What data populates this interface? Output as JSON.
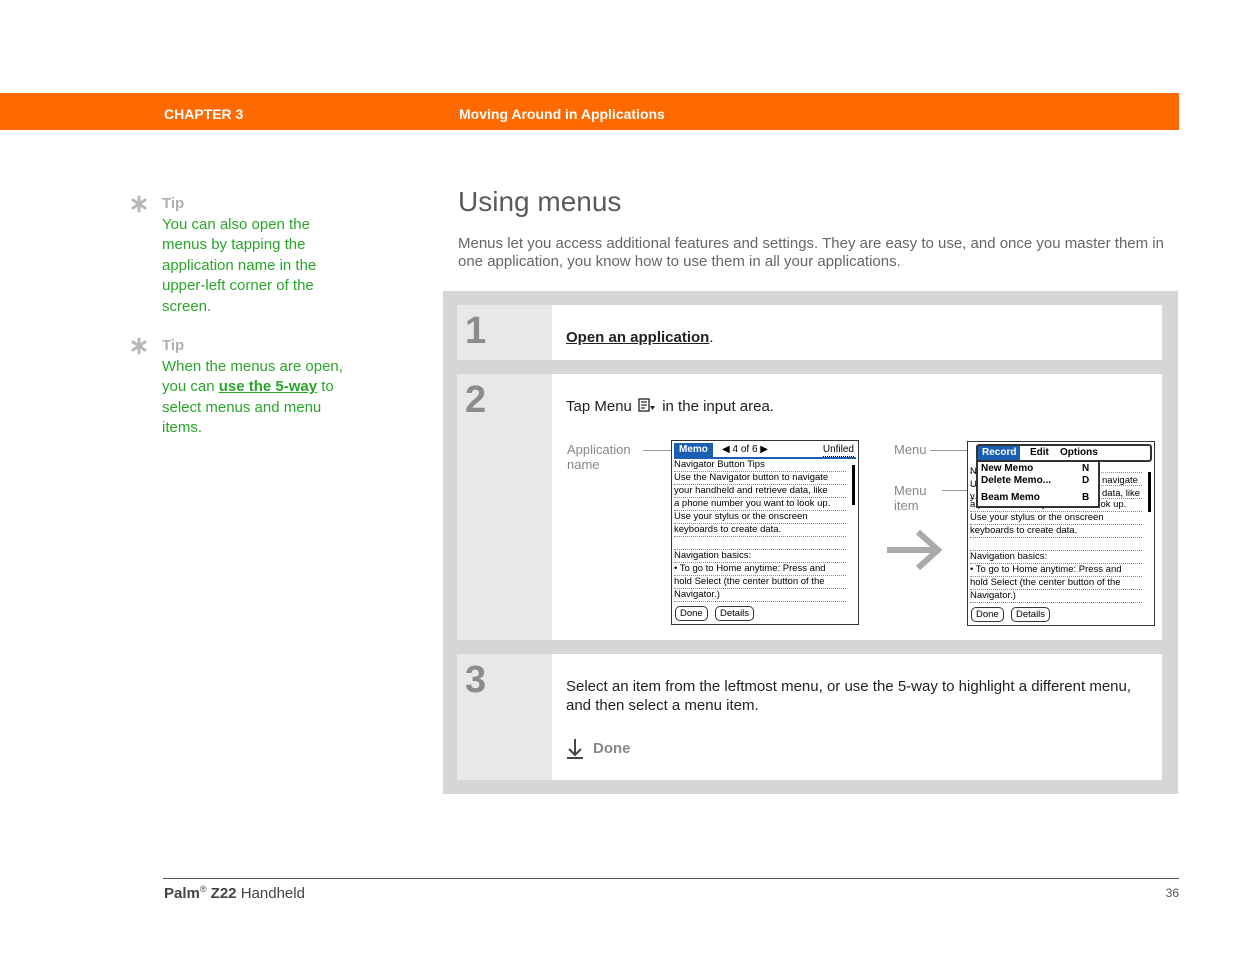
{
  "header": {
    "chapter": "CHAPTER 3",
    "title": "Moving Around in Applications",
    "color": "#ff6a00"
  },
  "tips": [
    {
      "label": "Tip",
      "text": "You can also open the menus by tapping the application name in the upper-left corner of the screen."
    },
    {
      "label": "Tip",
      "text_before": "When the menus are open, you can ",
      "link": "use the 5-way",
      "text_after": " to select menus and menu items."
    }
  ],
  "section": {
    "title": "Using menus",
    "intro": "Menus let you access additional features and settings. They are easy to use, and once you master them in one application, you know how to use them in all your applications."
  },
  "steps": [
    {
      "number": "1",
      "link": "Open an application",
      "after": "."
    },
    {
      "number": "2",
      "before": "Tap Menu",
      "after": "in the input area."
    },
    {
      "number": "3",
      "text": "Select an item from the leftmost menu, or use the 5-way to highlight a different menu, and then select a menu item."
    }
  ],
  "callouts": {
    "app_name": "Application name",
    "menu": "Menu",
    "menu_item": "Menu item"
  },
  "screen": {
    "tab": "Memo",
    "pager": "4 of 6",
    "category": "Unfiled",
    "lines": [
      "Navigator Button Tips",
      "Use the Navigator button to navigate",
      "your handheld and retrieve data, like",
      "a phone number you want to look up.",
      "Use your stylus or the onscreen",
      "keyboards to create data.",
      "",
      "Navigation basics:",
      "• To go to Home anytime: Press and",
      "hold Select (the center button of the",
      "Navigator.)"
    ],
    "btn_done": "Done",
    "btn_details": "Details"
  },
  "menu_screen": {
    "menus": [
      "Record",
      "Edit",
      "Options"
    ],
    "items": [
      {
        "label": "New Memo",
        "shortcut": "N"
      },
      {
        "label": "Delete Memo...",
        "shortcut": "D"
      },
      {
        "label": "Beam Memo",
        "shortcut": "B"
      }
    ],
    "lines": [
      "",
      "",
      "",
      "a phone number you want to look up.",
      "Use your stylus or the onscreen",
      "keyboards to create data.",
      "",
      "Navigation basics:",
      "• To go to Home anytime: Press and",
      "hold Select (the center button of the",
      "Navigator.)"
    ],
    "peek_right": [
      "navigate",
      "data, like"
    ],
    "peek_left": [
      "N",
      "U",
      "y"
    ]
  },
  "done_label": "Done",
  "footer": {
    "brand": "Palm",
    "reg": "®",
    "model": "Z22",
    "product": "Handheld",
    "page": "36"
  }
}
